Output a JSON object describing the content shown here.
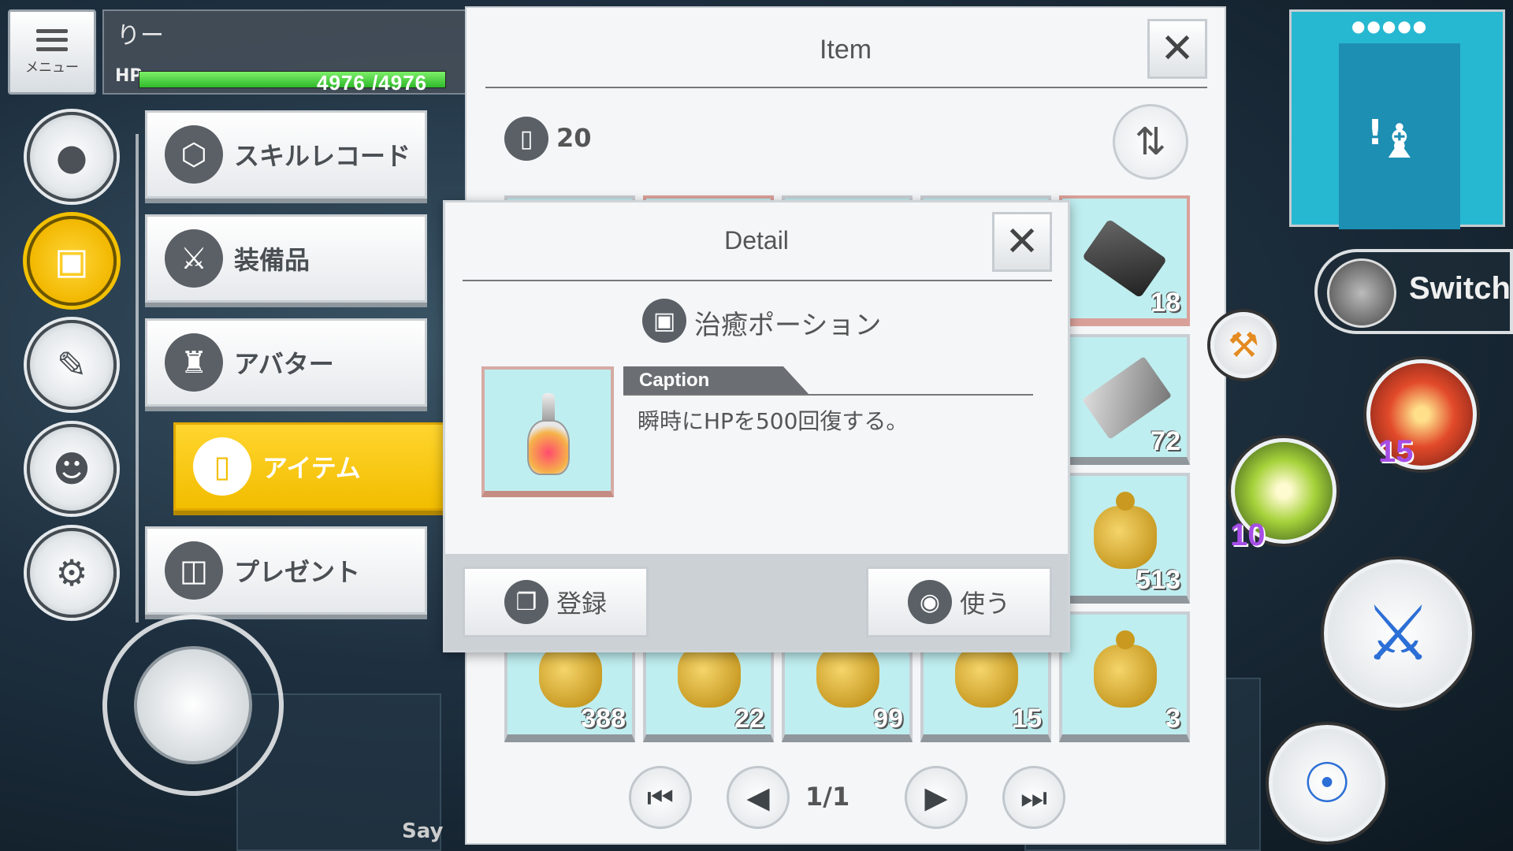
{
  "hud": {
    "menu_label": "メニュー",
    "player_name": "りー",
    "hp_label": "HP",
    "hp_text": "4976 /4976",
    "hp_fraction": 1.0
  },
  "side_buttons": [
    {
      "name": "profile",
      "icon": "person-icon"
    },
    {
      "name": "bag",
      "icon": "bag-icon",
      "active": true
    },
    {
      "name": "quest",
      "icon": "notebook-icon"
    },
    {
      "name": "friends",
      "icon": "friends-icon"
    },
    {
      "name": "settings",
      "icon": "gear-icon"
    }
  ],
  "menu": {
    "items": [
      {
        "label": "スキルレコード",
        "icon": "skill-record-icon"
      },
      {
        "label": "装備品",
        "icon": "equipment-icon"
      },
      {
        "label": "アバター",
        "icon": "avatar-icon"
      },
      {
        "label": "アイテム",
        "icon": "potion-icon",
        "active": true
      },
      {
        "label": "プレゼント",
        "icon": "gift-icon"
      }
    ]
  },
  "say_label": "Say",
  "item_panel": {
    "title": "Item",
    "count": "20",
    "slots": [
      {
        "qty": "18",
        "kind": "ingot"
      },
      {
        "qty": "72",
        "kind": "plate"
      },
      {
        "qty": "513",
        "kind": "bag"
      },
      {
        "qty": "3",
        "kind": "bag"
      },
      {
        "qty": "388",
        "kind": "bag"
      },
      {
        "qty": "22",
        "kind": "bag"
      },
      {
        "qty": "99",
        "kind": "bag"
      },
      {
        "qty": "15",
        "kind": "bag"
      }
    ],
    "pager": {
      "text": "1/1"
    }
  },
  "detail": {
    "title": "Detail",
    "item_name": "治癒ポーション",
    "caption_label": "Caption",
    "caption_text": "瞬時にHPを500回復する。",
    "register_label": "登録",
    "use_label": "使う"
  },
  "right_hud": {
    "switch_label": "Switch",
    "skill_red_cd": "15",
    "skill_green_cd": "10"
  },
  "colors": {
    "accent": "#f2bd00",
    "slot_bg": "#bfeef0",
    "minimap": "#27b8d1"
  }
}
